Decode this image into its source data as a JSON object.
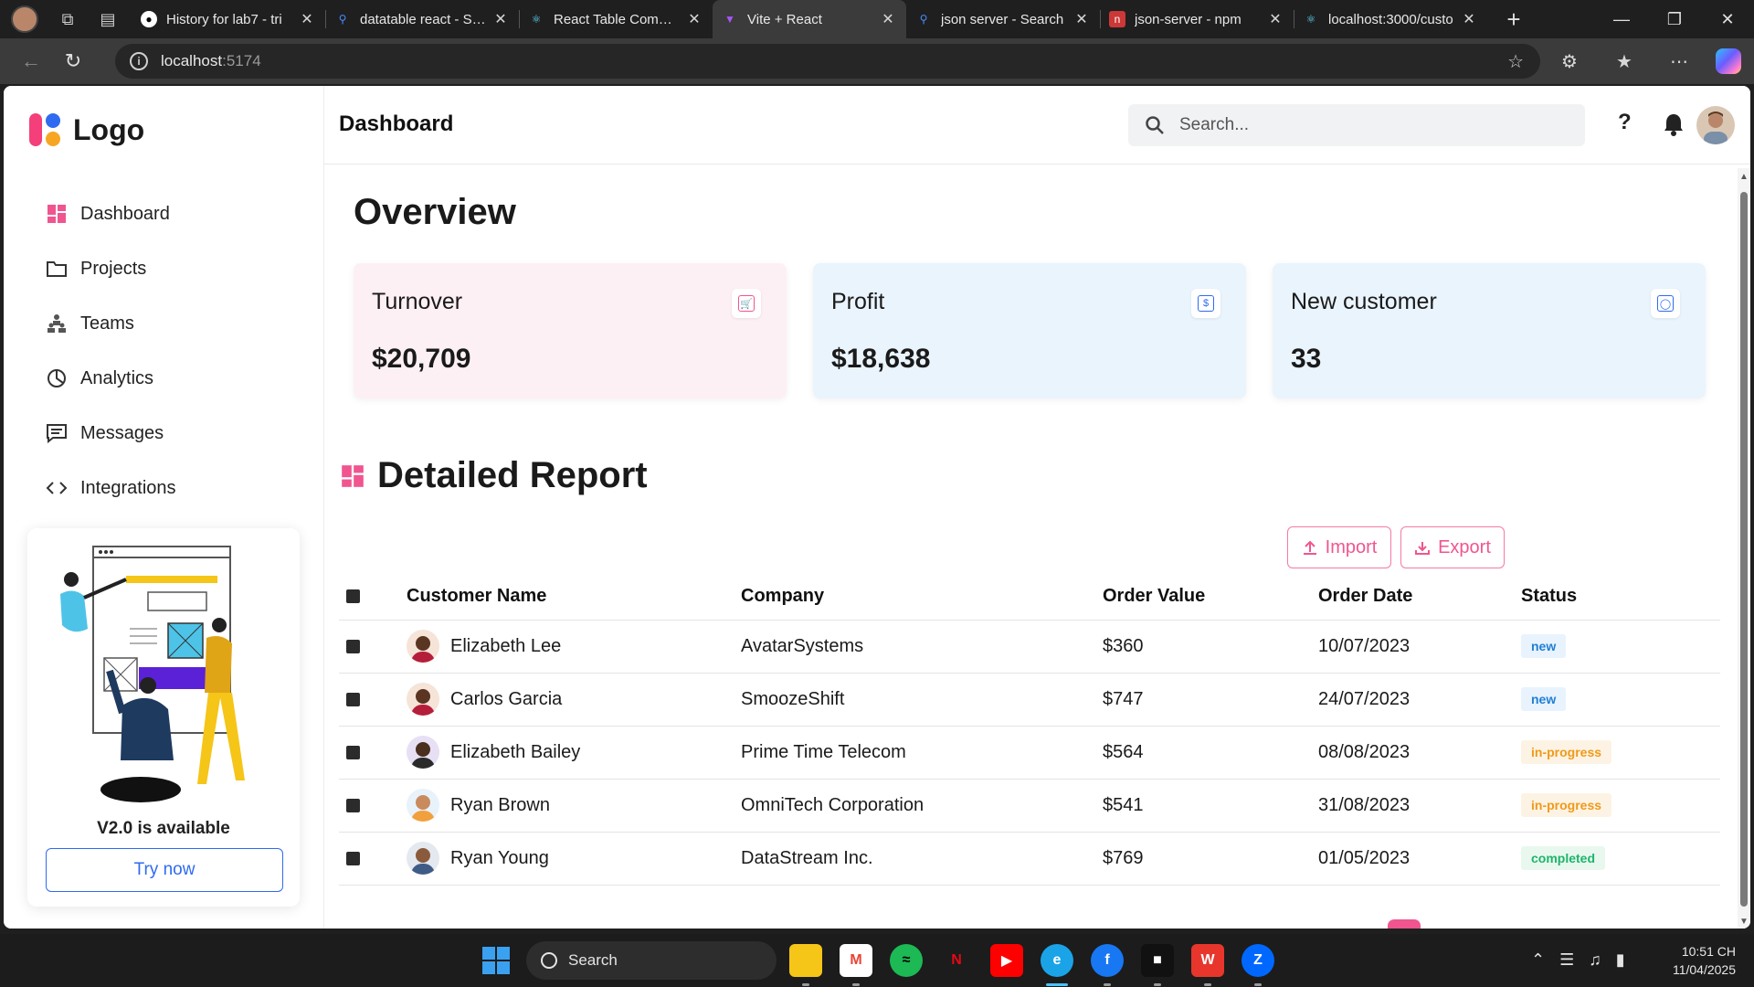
{
  "browser": {
    "tabs": [
      {
        "title": "History for lab7 - tri",
        "favicon": "github-icon"
      },
      {
        "title": "datatable react - Sea",
        "favicon": "bing-search-icon"
      },
      {
        "title": "React Table Compon",
        "favicon": "react-icon"
      },
      {
        "title": "Vite + React",
        "favicon": "vite-icon"
      },
      {
        "title": "json server - Search",
        "favicon": "bing-search-icon"
      },
      {
        "title": "json-server - npm",
        "favicon": "npm-icon"
      },
      {
        "title": "localhost:3000/custo",
        "favicon": "react-icon"
      }
    ],
    "active_tab": 3,
    "address": {
      "host": "localhost",
      "port": ":5174"
    }
  },
  "sidebar": {
    "logo_text": "Logo",
    "items": [
      {
        "label": "Dashboard",
        "icon": "dashboard-icon"
      },
      {
        "label": "Projects",
        "icon": "folder-icon"
      },
      {
        "label": "Teams",
        "icon": "teams-icon"
      },
      {
        "label": "Analytics",
        "icon": "pie-chart-icon"
      },
      {
        "label": "Messages",
        "icon": "message-icon"
      },
      {
        "label": "Integrations",
        "icon": "code-icon"
      }
    ],
    "promo": {
      "title": "V2.0 is available",
      "button": "Try now"
    }
  },
  "header": {
    "title": "Dashboard",
    "search_placeholder": "Search..."
  },
  "overview": {
    "title": "Overview",
    "cards": [
      {
        "label": "Turnover",
        "value": "$20,709",
        "icon": "cart-icon",
        "bg": "#fdf0f4"
      },
      {
        "label": "Profit",
        "value": "$18,638",
        "icon": "dollar-icon",
        "bg": "#eaf4fd"
      },
      {
        "label": "New customer",
        "value": "33",
        "icon": "customer-icon",
        "bg": "#eaf4fd"
      }
    ]
  },
  "report": {
    "title": "Detailed Report",
    "import_label": "Import",
    "export_label": "Export",
    "columns": [
      "Customer Name",
      "Company",
      "Order Value",
      "Order Date",
      "Status"
    ],
    "rows": [
      {
        "name": "Elizabeth Lee",
        "company": "AvatarSystems",
        "value": "$360",
        "date": "10/07/2023",
        "status": "new"
      },
      {
        "name": "Carlos Garcia",
        "company": "SmoozeShift",
        "value": "$747",
        "date": "24/07/2023",
        "status": "new"
      },
      {
        "name": "Elizabeth Bailey",
        "company": "Prime Time Telecom",
        "value": "$564",
        "date": "08/08/2023",
        "status": "in-progress"
      },
      {
        "name": "Ryan Brown",
        "company": "OmniTech Corporation",
        "value": "$541",
        "date": "31/08/2023",
        "status": "in-progress"
      },
      {
        "name": "Ryan Young",
        "company": "DataStream Inc.",
        "value": "$769",
        "date": "01/05/2023",
        "status": "completed"
      }
    ]
  },
  "taskbar": {
    "search_label": "Search",
    "apps": [
      "file-explorer-icon",
      "gmail-icon",
      "spotify-icon",
      "netflix-icon",
      "youtube-icon",
      "edge-icon",
      "facebook-icon",
      "capcut-icon",
      "wps-office-icon",
      "zalo-icon"
    ],
    "time": "10:51 CH",
    "date": "11/04/2025"
  },
  "colors": {
    "accent": "#f0558f",
    "brand_blue": "#2f6bf0"
  }
}
